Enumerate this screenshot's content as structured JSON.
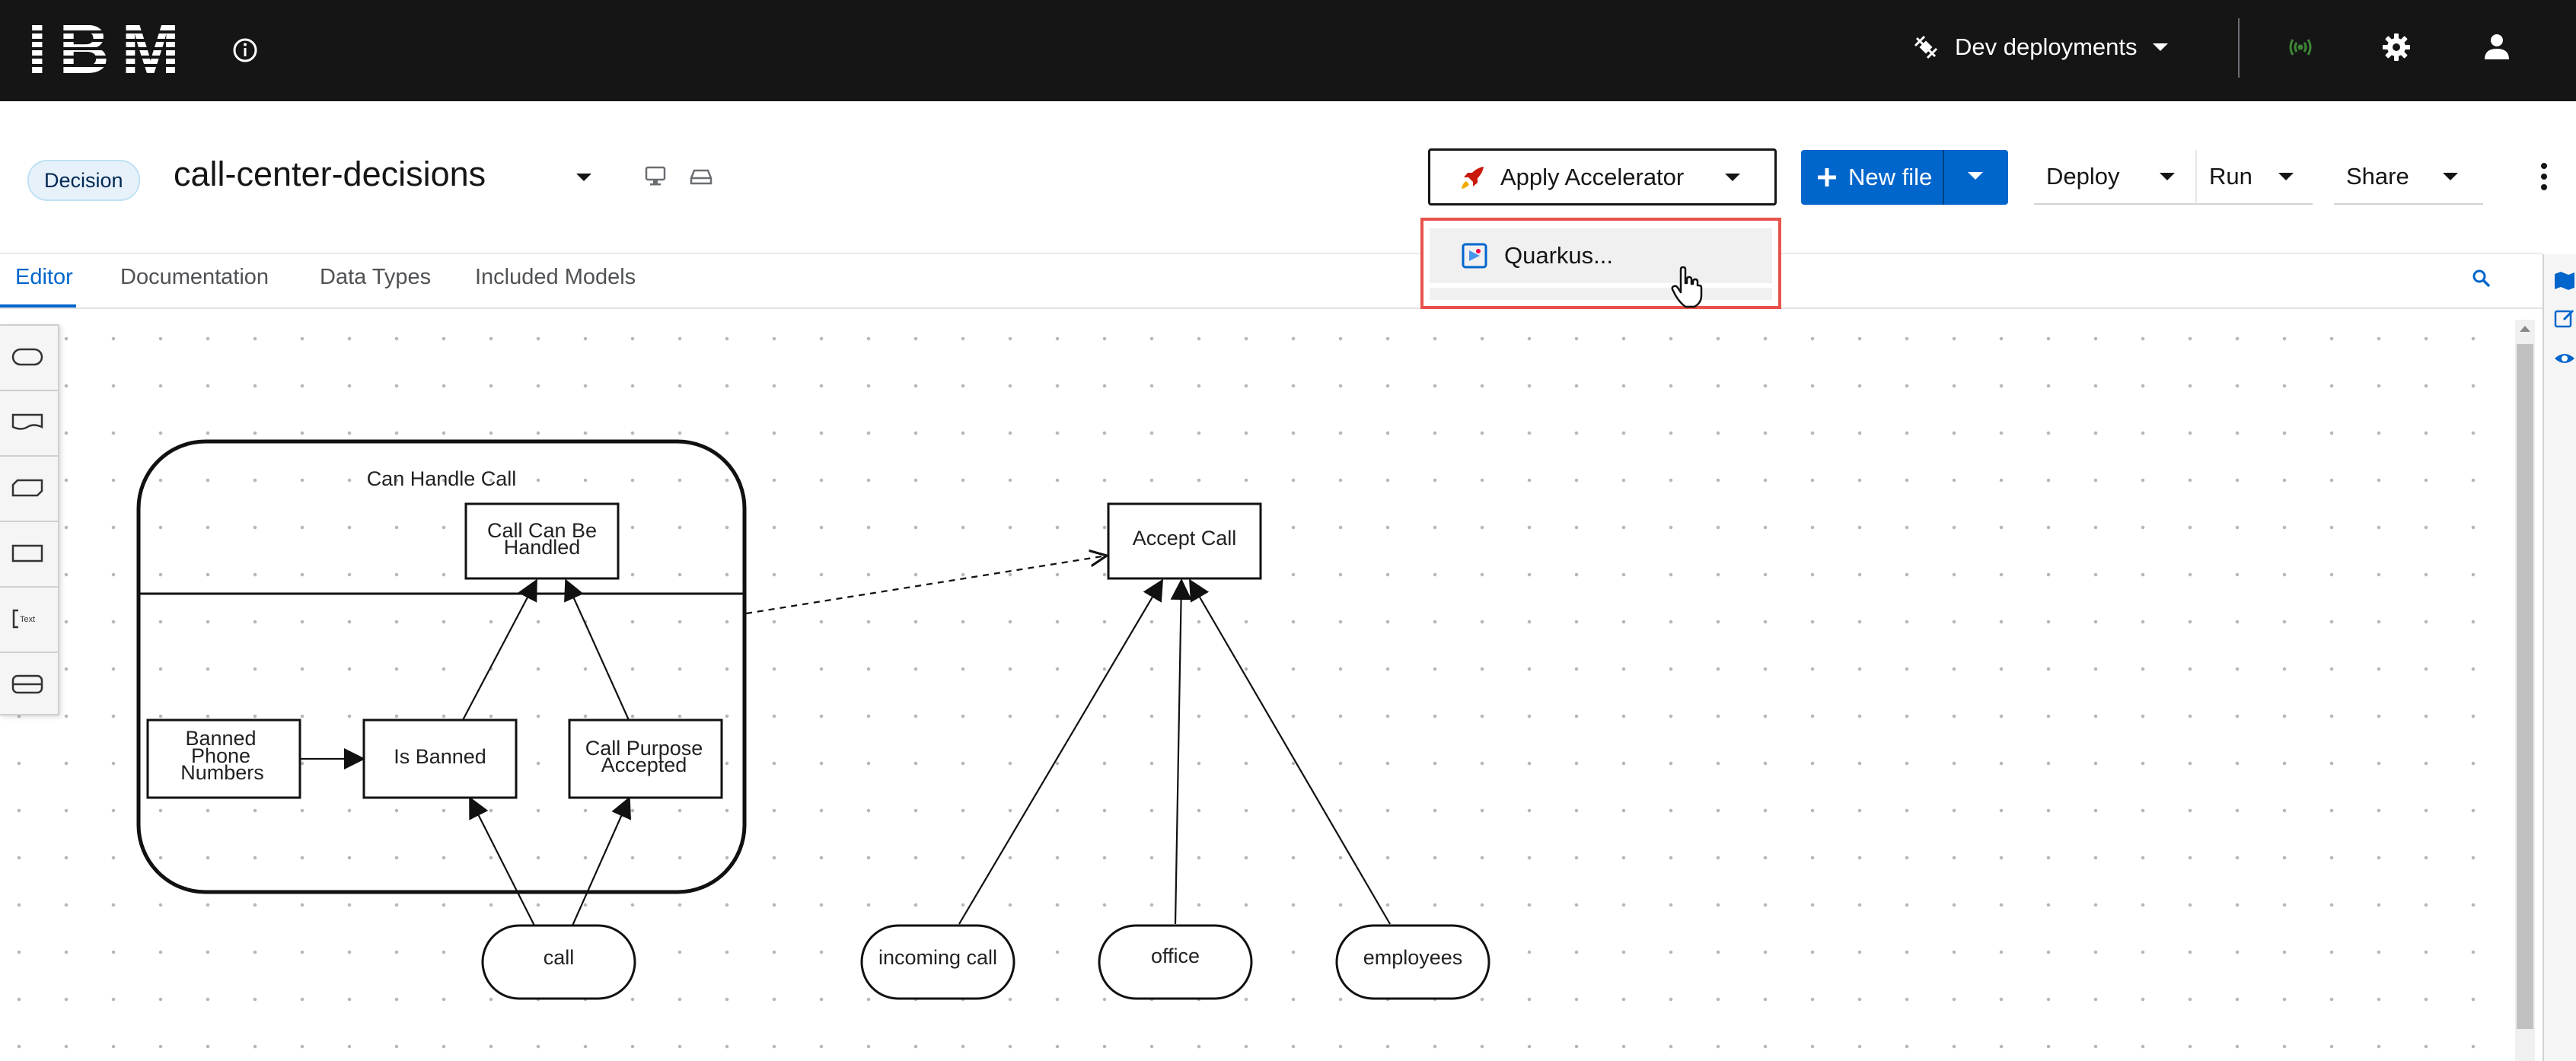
{
  "masthead": {
    "logo_text": "IBM",
    "dev_deployments_label": "Dev deployments",
    "icons": [
      "info-icon",
      "satellite-icon",
      "broadcast-icon",
      "gear-icon",
      "user-icon"
    ],
    "broadcast_color": "#3e8635"
  },
  "header": {
    "type_badge": "Decision",
    "file_name": "call-center-decisions",
    "apply_accelerator_label": "Apply Accelerator",
    "new_file_label": "New file",
    "deploy_label": "Deploy",
    "run_label": "Run",
    "share_label": "Share",
    "accent_color": "#0066cc"
  },
  "accelerator_menu": {
    "items": [
      "Quarkus..."
    ],
    "highlight_color": "#e8524b"
  },
  "tabs": [
    "Editor",
    "Documentation",
    "Data Types",
    "Included Models"
  ],
  "active_tab": "Editor",
  "palette": {
    "tools": [
      "input-data-tool",
      "knowledge-source-tool",
      "bkm-tool",
      "decision-tool",
      "text-annotation-tool",
      "decision-service-tool"
    ],
    "annotation_label": "Text"
  },
  "diagram": {
    "decision_service": "Can Handle Call",
    "nodes": {
      "call_can_be_handled": [
        "Call Can Be",
        "Handled"
      ],
      "accept_call": "Accept Call",
      "banned_phone_numbers": [
        "Banned",
        "Phone",
        "Numbers"
      ],
      "is_banned": "Is Banned",
      "call_purpose_accepted": [
        "Call Purpose",
        "Accepted"
      ],
      "call": "call",
      "incoming_call": "incoming call",
      "office": "office",
      "employees": "employees"
    }
  }
}
